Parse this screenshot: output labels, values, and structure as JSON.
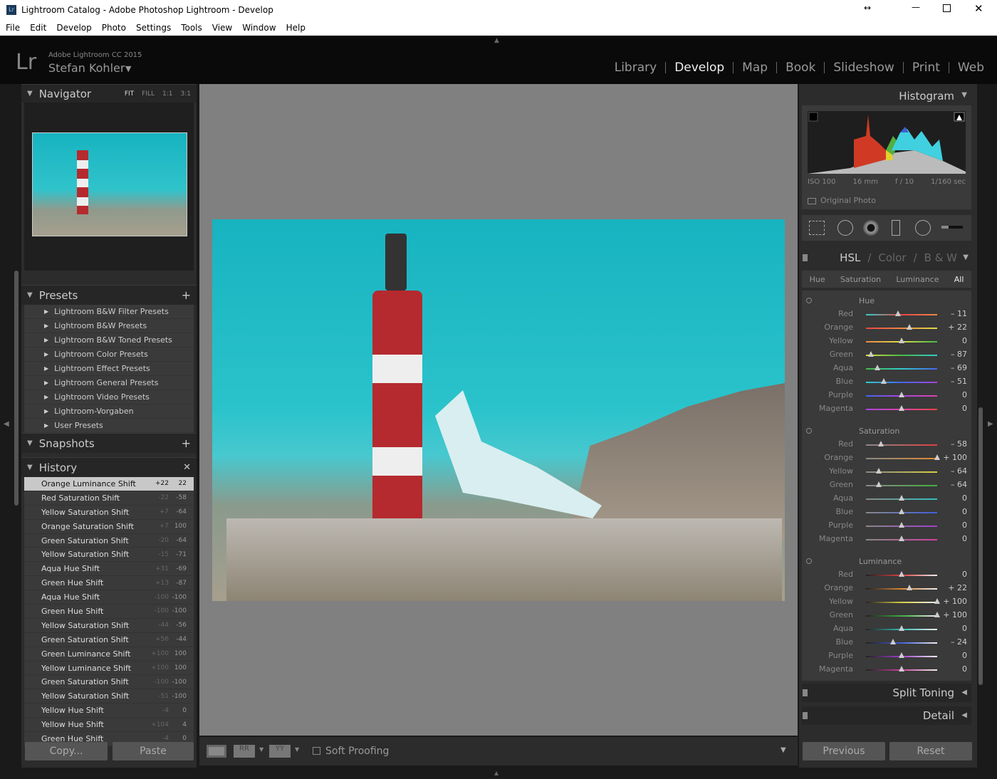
{
  "window": {
    "title": "Lightroom Catalog - Adobe Photoshop Lightroom - Develop",
    "app_icon": "Lr"
  },
  "menu": [
    "File",
    "Edit",
    "Develop",
    "Photo",
    "Settings",
    "Tools",
    "View",
    "Window",
    "Help"
  ],
  "identity": {
    "logo": "Lr",
    "product": "Adobe Lightroom CC 2015",
    "user": "Stefan Kohler"
  },
  "modules": [
    "Library",
    "Develop",
    "Map",
    "Book",
    "Slideshow",
    "Print",
    "Web"
  ],
  "active_module": "Develop",
  "navigator": {
    "title": "Navigator",
    "zoom": [
      "FIT",
      "FILL",
      "1:1",
      "3:1"
    ]
  },
  "presets": {
    "title": "Presets",
    "items": [
      "Lightroom B&W Filter Presets",
      "Lightroom B&W Presets",
      "Lightroom B&W Toned Presets",
      "Lightroom Color Presets",
      "Lightroom Effect Presets",
      "Lightroom General Presets",
      "Lightroom Video Presets",
      "Lightroom-Vorgaben",
      "User Presets"
    ]
  },
  "snapshots": {
    "title": "Snapshots"
  },
  "history": {
    "title": "History",
    "items": [
      [
        "Orange Luminance Shift",
        "+22",
        "22"
      ],
      [
        "Red Saturation Shift",
        "-22",
        "-58"
      ],
      [
        "Yellow Saturation Shift",
        "+7",
        "-64"
      ],
      [
        "Orange Saturation Shift",
        "+7",
        "100"
      ],
      [
        "Green Saturation Shift",
        "-20",
        "-64"
      ],
      [
        "Yellow Saturation Shift",
        "-15",
        "-71"
      ],
      [
        "Aqua Hue Shift",
        "+31",
        "-69"
      ],
      [
        "Green Hue Shift",
        "+13",
        "-87"
      ],
      [
        "Aqua Hue Shift",
        "-100",
        "-100"
      ],
      [
        "Green Hue Shift",
        "-100",
        "-100"
      ],
      [
        "Yellow Saturation Shift",
        "-44",
        "-56"
      ],
      [
        "Green Saturation Shift",
        "+56",
        "-44"
      ],
      [
        "Green Luminance Shift",
        "+100",
        "100"
      ],
      [
        "Yellow Luminance Shift",
        "+100",
        "100"
      ],
      [
        "Green Saturation Shift",
        "-100",
        "-100"
      ],
      [
        "Yellow Saturation Shift",
        "-51",
        "-100"
      ],
      [
        "Yellow Hue Shift",
        "-4",
        "0"
      ],
      [
        "Yellow Hue Shift",
        "+104",
        "4"
      ],
      [
        "Green Hue Shift",
        "-4",
        "0"
      ]
    ]
  },
  "left_buttons": {
    "copy": "Copy...",
    "paste": "Paste"
  },
  "toolbar": {
    "soft_proofing": "Soft Proofing"
  },
  "histogram": {
    "title": "Histogram",
    "iso": "ISO 100",
    "focal": "16 mm",
    "aperture": "f / 10",
    "shutter": "1/160 sec",
    "original_photo": "Original Photo"
  },
  "hsl": {
    "header": [
      "HSL",
      "Color",
      "B & W"
    ],
    "tabs": [
      "Hue",
      "Saturation",
      "Luminance",
      "All"
    ],
    "active_tab": "All",
    "colors": [
      "Red",
      "Orange",
      "Yellow",
      "Green",
      "Aqua",
      "Blue",
      "Purple",
      "Magenta"
    ],
    "swatches": [
      "#e04040",
      "#e08a30",
      "#d8d040",
      "#40b040",
      "#30c0c0",
      "#4060e0",
      "#a040d0",
      "#d040a0"
    ],
    "groups": [
      {
        "name": "Hue",
        "values": [
          "– 11",
          "+ 22",
          "0",
          "– 87",
          "– 69",
          "– 51",
          "0",
          "0"
        ],
        "nums": [
          -11,
          22,
          0,
          -87,
          -69,
          -51,
          0,
          0
        ]
      },
      {
        "name": "Saturation",
        "values": [
          "– 58",
          "+ 100",
          "– 64",
          "– 64",
          "0",
          "0",
          "0",
          "0"
        ],
        "nums": [
          -58,
          100,
          -64,
          -64,
          0,
          0,
          0,
          0
        ]
      },
      {
        "name": "Luminance",
        "values": [
          "0",
          "+ 22",
          "+ 100",
          "+ 100",
          "0",
          "– 24",
          "0",
          "0"
        ],
        "nums": [
          0,
          22,
          100,
          100,
          0,
          -24,
          0,
          0
        ]
      }
    ]
  },
  "panels": {
    "split_toning": "Split Toning",
    "detail": "Detail"
  },
  "right_buttons": {
    "previous": "Previous",
    "reset": "Reset"
  }
}
